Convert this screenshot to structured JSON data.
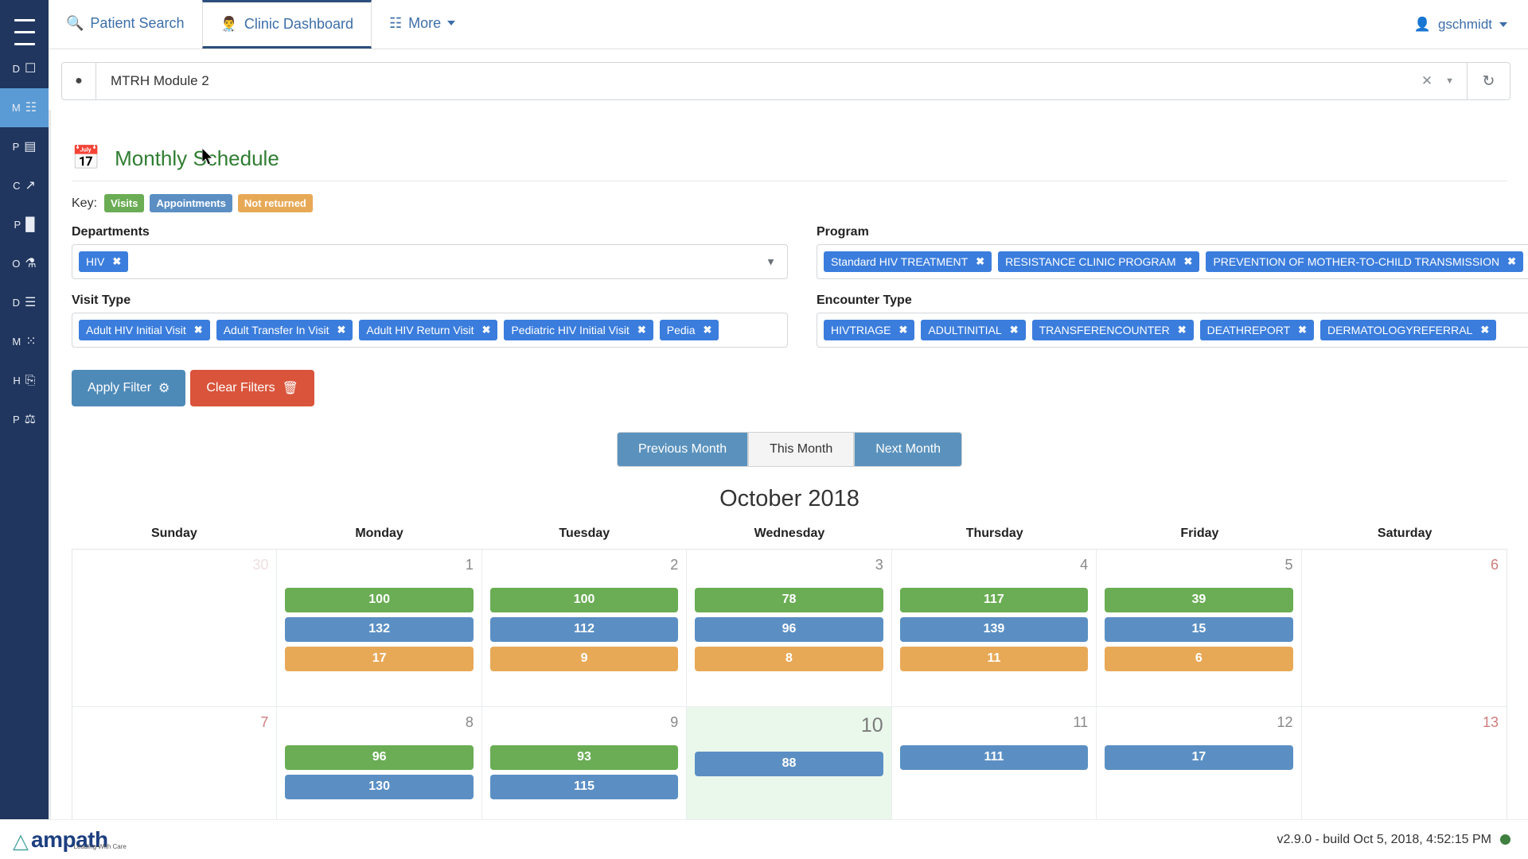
{
  "topnav": {
    "hamburger_icon": "hamburger-menu-icon",
    "tabs": [
      {
        "label": "Patient Search",
        "icon": "search-icon",
        "active": false
      },
      {
        "label": "Clinic Dashboard",
        "icon": "doctor-icon",
        "active": true
      },
      {
        "label": "More",
        "icon": "grid-icon",
        "active": false
      }
    ],
    "user": {
      "label": "gschmidt",
      "icon": "user-icon"
    }
  },
  "sidebar": {
    "items": [
      {
        "letter": "D",
        "glyph": "☐",
        "icon": "calendar-day-icon",
        "active": false
      },
      {
        "letter": "M",
        "glyph": "☷",
        "icon": "calendar-month-icon",
        "active": true
      },
      {
        "letter": "P",
        "glyph": "▤",
        "icon": "patient-list-icon",
        "active": false
      },
      {
        "letter": "C",
        "glyph": "↗",
        "icon": "trend-chart-icon",
        "active": false
      },
      {
        "letter": "P",
        "glyph": "█",
        "icon": "bar-chart-icon",
        "active": false
      },
      {
        "letter": "O",
        "glyph": "⚗",
        "icon": "microscope-icon",
        "active": false
      },
      {
        "letter": "D",
        "glyph": "☰",
        "icon": "data-list-icon",
        "active": false
      },
      {
        "letter": "M",
        "glyph": "⁙",
        "icon": "matrix-icon",
        "active": false
      },
      {
        "letter": "H",
        "glyph": "⎘",
        "icon": "pdf-file-icon",
        "active": false
      },
      {
        "letter": "P",
        "glyph": "⚖",
        "icon": "report-pdf-icon",
        "active": false
      }
    ]
  },
  "location_bar": {
    "pin_icon": "location-pin-icon",
    "value": "MTRH Module 2",
    "clear_icon": "clear-x-icon",
    "caret_icon": "chevron-down-icon",
    "refresh_icon": "refresh-icon"
  },
  "page": {
    "title": "Monthly Schedule",
    "title_icon": "calendar-icon"
  },
  "key": {
    "label": "Key:",
    "chips": [
      {
        "label": "Visits",
        "color": "#6aad54"
      },
      {
        "label": "Appointments",
        "color": "#5b8fc4"
      },
      {
        "label": "Not returned",
        "color": "#e8a957"
      }
    ]
  },
  "filters": {
    "departments": {
      "label": "Departments",
      "chips": [
        "HIV"
      ]
    },
    "program": {
      "label": "Program",
      "chips": [
        "Standard HIV TREATMENT",
        "RESISTANCE CLINIC PROGRAM",
        "PREVENTION OF MOTHER-TO-CHILD TRANSMISSION"
      ]
    },
    "visit_type": {
      "label": "Visit Type",
      "chips": [
        "Adult HIV Initial Visit",
        "Adult Transfer In Visit",
        "Adult HIV Return Visit",
        "Pediatric HIV Initial Visit",
        "Pedia"
      ]
    },
    "encounter_type": {
      "label": "Encounter Type",
      "chips": [
        "HIVTRIAGE",
        "ADULTINITIAL",
        "TRANSFERENCOUNTER",
        "DEATHREPORT",
        "DERMATOLOGYREFERRAL"
      ]
    }
  },
  "actions": {
    "apply_label": "Apply Filter",
    "apply_icon": "gear-icon",
    "clear_label": "Clear Filters",
    "clear_icon": "trash-icon"
  },
  "month_nav": {
    "previous": "Previous Month",
    "current": "This Month",
    "next": "Next Month"
  },
  "calendar": {
    "title": "October 2018",
    "dow": [
      "Sunday",
      "Monday",
      "Tuesday",
      "Wednesday",
      "Thursday",
      "Friday",
      "Saturday"
    ],
    "weeks": [
      [
        {
          "num": "30",
          "state": "muted",
          "bars": []
        },
        {
          "num": "1",
          "state": "normal",
          "bars": [
            {
              "t": "visits",
              "v": "100"
            },
            {
              "t": "appts",
              "v": "132"
            },
            {
              "t": "notret",
              "v": "17"
            }
          ]
        },
        {
          "num": "2",
          "state": "normal",
          "bars": [
            {
              "t": "visits",
              "v": "100"
            },
            {
              "t": "appts",
              "v": "112"
            },
            {
              "t": "notret",
              "v": "9"
            }
          ]
        },
        {
          "num": "3",
          "state": "normal",
          "bars": [
            {
              "t": "visits",
              "v": "78"
            },
            {
              "t": "appts",
              "v": "96"
            },
            {
              "t": "notret",
              "v": "8"
            }
          ]
        },
        {
          "num": "4",
          "state": "normal",
          "bars": [
            {
              "t": "visits",
              "v": "117"
            },
            {
              "t": "appts",
              "v": "139"
            },
            {
              "t": "notret",
              "v": "11"
            }
          ]
        },
        {
          "num": "5",
          "state": "normal",
          "bars": [
            {
              "t": "visits",
              "v": "39"
            },
            {
              "t": "appts",
              "v": "15"
            },
            {
              "t": "notret",
              "v": "6"
            }
          ]
        },
        {
          "num": "6",
          "state": "weekend",
          "bars": []
        }
      ],
      [
        {
          "num": "7",
          "state": "weekend",
          "bars": []
        },
        {
          "num": "8",
          "state": "normal",
          "bars": [
            {
              "t": "visits",
              "v": "96"
            },
            {
              "t": "appts",
              "v": "130"
            }
          ]
        },
        {
          "num": "9",
          "state": "normal",
          "bars": [
            {
              "t": "visits",
              "v": "93"
            },
            {
              "t": "appts",
              "v": "115"
            }
          ]
        },
        {
          "num": "10",
          "state": "today",
          "bars": [
            {
              "t": "appts",
              "v": "88"
            }
          ]
        },
        {
          "num": "11",
          "state": "normal",
          "bars": [
            {
              "t": "appts",
              "v": "111"
            }
          ]
        },
        {
          "num": "12",
          "state": "normal",
          "bars": [
            {
              "t": "appts",
              "v": "17"
            }
          ]
        },
        {
          "num": "13",
          "state": "weekend",
          "bars": []
        }
      ]
    ]
  },
  "footer": {
    "logo_word": "ampath",
    "logo_tagline": "Leading With Care",
    "version": "v2.9.0 - build Oct 5, 2018, 4:52:15 PM",
    "status_color": "#3f7f3f"
  }
}
